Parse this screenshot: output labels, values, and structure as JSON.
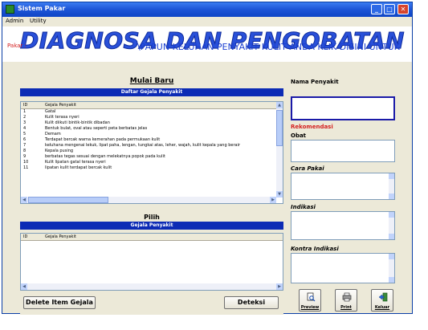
{
  "window": {
    "title": "Sistem Pakar",
    "controls": {
      "minimize": "_",
      "maximize": "□",
      "close": "✕"
    }
  },
  "menu": {
    "items": [
      "Admin",
      "Utility"
    ]
  },
  "banner": {
    "title": "DIAGNOSA DAN PENGOBATAN PENYAKIT KULIT",
    "pakar_label": "Pakar :",
    "marquee": "\\PAPUN KELUHAN PENYAKIT KULIT ANDA KLIK DISINI UNTUK"
  },
  "left": {
    "mulai_baru_label": "Mulai Baru",
    "daftar_header": "Daftar Gejala Penyakit",
    "columns": {
      "id": "ID",
      "name": "Gejala Penyakit"
    },
    "rows": [
      {
        "id": "1",
        "name": "Gatal"
      },
      {
        "id": "2",
        "name": "Kulit terasa nyeri"
      },
      {
        "id": "3",
        "name": "Kulit diikuti bintik-bintik dibadan"
      },
      {
        "id": "4",
        "name": "Bentuk bulat, oval atau seperti peta berbatas jelas"
      },
      {
        "id": "5",
        "name": "Demam"
      },
      {
        "id": "6",
        "name": "Terdapat bercak warna kemerahan pada permukaan kulit"
      },
      {
        "id": "7",
        "name": "keluhana mengenai lekuk, lipat paha, lengan, tungkai atas, leher, wajah, kulit kepala yang berair"
      },
      {
        "id": "8",
        "name": "Kepala pusing"
      },
      {
        "id": "9",
        "name": "berbatas tegas sesuai dengan melekatnya popok pada kulit"
      },
      {
        "id": "10",
        "name": "Kulit lipatan gatal terasa nyeri"
      },
      {
        "id": "11",
        "name": "lipatan kulit terdapat bercak kulit"
      }
    ],
    "pilih_label": "Pilih",
    "pilih_header": "Gejala Penyakit",
    "pilih_columns": {
      "id": "ID",
      "name": "Gejala Penyakit"
    },
    "delete_button": "Delete Item Gejala",
    "deteksi_button": "Deteksi"
  },
  "right": {
    "nama_label": "Nama Penyakit",
    "rekomendasi_label": "Rekomendasi",
    "obat_label": "Obat",
    "cara_label": "Cara Pakai",
    "indikasi_label": "Indikasi",
    "kontra_label": "Kontra Indikasi",
    "preview_label": "Preview",
    "print_label": "Print",
    "keluar_label": "Keluar"
  },
  "colors": {
    "titlebar": "#1f57d8",
    "header_bar": "#0c2bb5",
    "banner_text": "#2950d9",
    "label_red": "#d42020"
  }
}
